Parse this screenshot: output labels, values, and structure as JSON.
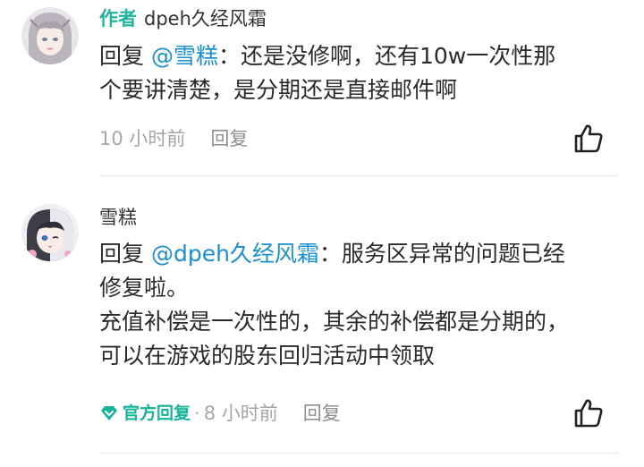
{
  "comments": [
    {
      "author_tag": "作者",
      "username": "dpeh久经风霜",
      "reply_prefix": "回复 ",
      "mention": "@雪糕",
      "lines": [
        "：还是没修啊，还有10w一次性那",
        "个要讲清楚，是分期还是直接邮件啊"
      ],
      "time": "10 小时前",
      "reply_label": "回复",
      "like_icon": "thumbs-up-icon"
    },
    {
      "username": "雪糕",
      "reply_prefix": "回复 ",
      "mention": "@dpeh久经风霜",
      "lines": [
        "：服务区异常的问题已经",
        "修复啦。",
        "充值补偿是一次性的，其余的补偿都是分期的，",
        "可以在游戏的股东回归活动中领取"
      ],
      "official_label": "官方回复",
      "separator": "·",
      "time": "8 小时前",
      "reply_label": "回复",
      "like_icon": "thumbs-up-icon"
    }
  ],
  "colors": {
    "author_tag": "#1fb59d",
    "mention": "#1b8fd0",
    "official": "#16b39b",
    "meta": "#a6a6a6"
  }
}
